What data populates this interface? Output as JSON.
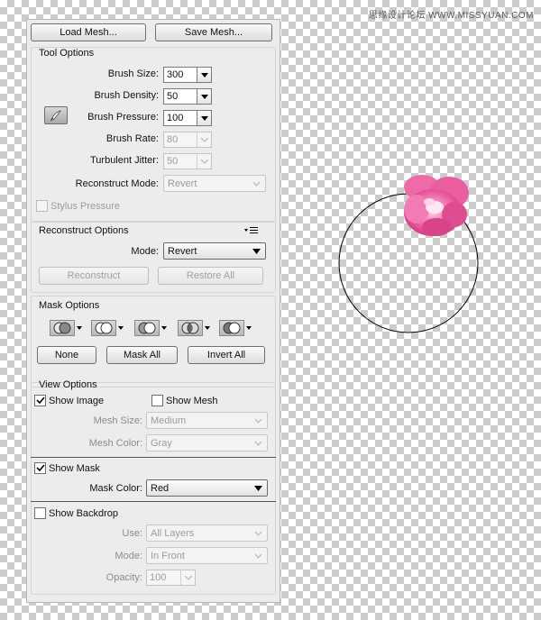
{
  "watermark": "思缘设计论坛 WWW.MISSYUAN.COM",
  "top_buttons": {
    "load_label": "Load Mesh...",
    "save_label": "Save Mesh..."
  },
  "tool_options": {
    "title": "Tool Options",
    "brush_size": {
      "label": "Brush Size:",
      "value": "300"
    },
    "brush_density": {
      "label": "Brush Density:",
      "value": "50"
    },
    "brush_pressure": {
      "label": "Brush Pressure:",
      "value": "100"
    },
    "brush_rate": {
      "label": "Brush Rate:",
      "value": "80"
    },
    "turbulent_jitter": {
      "label": "Turbulent Jitter:",
      "value": "50"
    },
    "reconstruct_mode": {
      "label": "Reconstruct Mode:",
      "value": "Revert"
    },
    "stylus_pressure_label": "Stylus Pressure"
  },
  "reconstruct_options": {
    "title": "Reconstruct Options",
    "mode_label": "Mode:",
    "mode_value": "Revert",
    "reconstruct_label": "Reconstruct",
    "restore_all_label": "Restore All"
  },
  "mask_options": {
    "title": "Mask Options",
    "none_label": "None",
    "mask_all_label": "Mask All",
    "invert_all_label": "Invert All"
  },
  "view_options": {
    "title": "View Options",
    "show_image_label": "Show Image",
    "show_image_checked": true,
    "show_mesh_label": "Show Mesh",
    "show_mesh_checked": false,
    "mesh_size_label": "Mesh Size:",
    "mesh_size_value": "Medium",
    "mesh_color_label": "Mesh Color:",
    "mesh_color_value": "Gray",
    "show_mask_label": "Show Mask",
    "show_mask_checked": true,
    "mask_color_label": "Mask Color:",
    "mask_color_value": "Red",
    "show_backdrop_label": "Show Backdrop",
    "show_backdrop_checked": false,
    "use_label": "Use:",
    "use_value": "All Layers",
    "mode_label": "Mode:",
    "mode_value": "In Front",
    "opacity_label": "Opacity:",
    "opacity_value": "100"
  },
  "colors": {
    "panel_bg": "#ececec",
    "brush_circle": "#000000",
    "flower_pink": "#e8559a"
  }
}
